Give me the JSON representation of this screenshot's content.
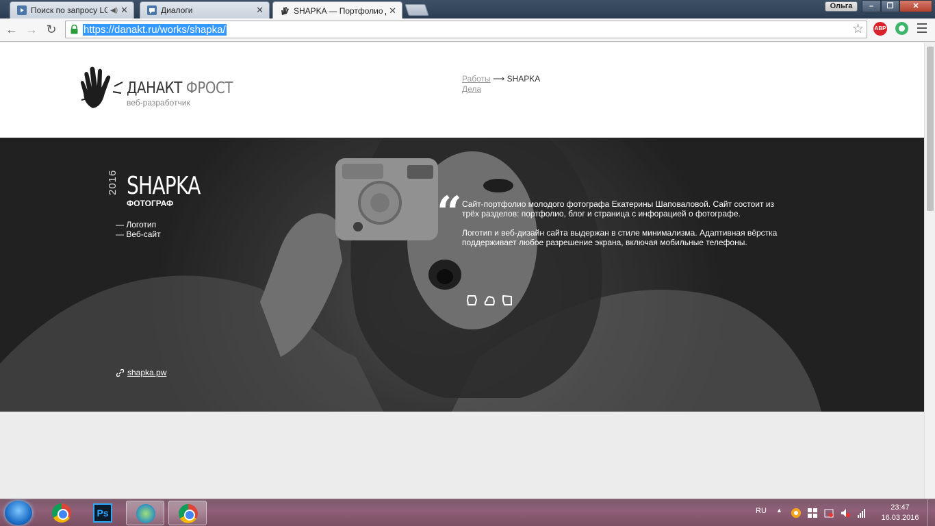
{
  "browser": {
    "tabs": [
      {
        "title": "Поиск по запросу LOE",
        "icon": "vk-video-icon",
        "audio": true
      },
      {
        "title": "Диалоги",
        "icon": "vk-messages-icon"
      },
      {
        "title": "SHAPKA — Портфолио Д",
        "icon": "hand-logo-icon",
        "active": true
      }
    ],
    "user": "Ольга",
    "window_buttons": {
      "minimize": "–",
      "maximize": "❐",
      "close": "✕"
    },
    "url": "https://danakt.ru/works/shapka/",
    "ext_abp": "ABP"
  },
  "site": {
    "logo": {
      "name_bold": "ДАНАКТ",
      "name_light": "ФРОСТ",
      "subtitle": "веб-разработчик"
    },
    "breadcrumb": {
      "works": "Работы",
      "arrow": " ⟶ ",
      "current": "SHAPKA",
      "deals": "Дела"
    },
    "project": {
      "year": "2016",
      "title": "SHAPKA",
      "subtitle": "ФОТОГРАФ",
      "services": [
        "Логотип",
        "Веб-сайт"
      ],
      "description": [
        "Сайт-портфолио молодого фотографа Екатерины Шаповаловой. Сайт состоит из трёх разделов: портфолио, блог и страница с инфорацией о фотографе.",
        "Логотип и веб-дизайн сайта выдержан в стиле минимализма. Адаптивная вёрстка поддерживает любое разрешение экрана, включая мобильные телефоны."
      ],
      "link": "shapka.pw"
    }
  },
  "taskbar": {
    "language": "RU",
    "time": "23:47",
    "date": "16.03.2016",
    "ps_label": "Ps"
  }
}
